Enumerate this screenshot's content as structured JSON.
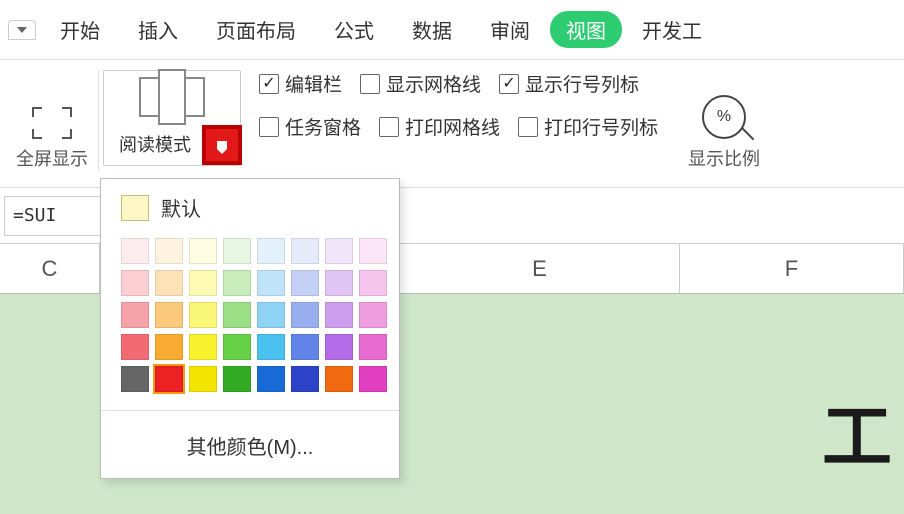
{
  "menu": {
    "items": [
      "开始",
      "插入",
      "页面布局",
      "公式",
      "数据",
      "审阅",
      "视图",
      "开发工"
    ],
    "active_index": 6
  },
  "ribbon": {
    "fullscreen_label": "全屏显示",
    "reading_group_label": "阅读模式",
    "checks": {
      "row1": [
        {
          "label": "编辑栏",
          "checked": true
        },
        {
          "label": "显示网格线",
          "checked": false
        },
        {
          "label": "显示行号列标",
          "checked": true
        }
      ],
      "row2": [
        {
          "label": "任务窗格",
          "checked": false
        },
        {
          "label": "打印网格线",
          "checked": false
        },
        {
          "label": "打印行号列标",
          "checked": false
        }
      ]
    },
    "zoom_label": "显示比例",
    "zoom_pct": "%"
  },
  "formula_bar": {
    "value": "=SUI"
  },
  "columns": {
    "c": "C",
    "e": "E",
    "f": "F"
  },
  "sheet": {
    "big_text": "工"
  },
  "color_panel": {
    "default_label": "默认",
    "more_label": "其他颜色(M)...",
    "selected_index": 33,
    "swatches": [
      "#fdecee",
      "#fef3de",
      "#fefde1",
      "#e8f6e1",
      "#e3f1fb",
      "#e6ebfb",
      "#f1e5fa",
      "#fbe5f6",
      "#fbcfd3",
      "#fde2b8",
      "#fdfab3",
      "#c9edba",
      "#bfe3f8",
      "#c4d0f6",
      "#e1c5f5",
      "#f6c5ed",
      "#f7a1a8",
      "#fbc97b",
      "#faf778",
      "#9adf85",
      "#8fd3f4",
      "#98aeef",
      "#cd9eee",
      "#ef9ee0",
      "#f26a74",
      "#f7ac31",
      "#f6f22b",
      "#66d047",
      "#4bc1f0",
      "#6284e8",
      "#b46be7",
      "#e76bd1",
      "#666666",
      "#ed2024",
      "#f4e500",
      "#33ab24",
      "#186bd6",
      "#2c43c9",
      "#f26a0f",
      "#e23ec0"
    ]
  }
}
